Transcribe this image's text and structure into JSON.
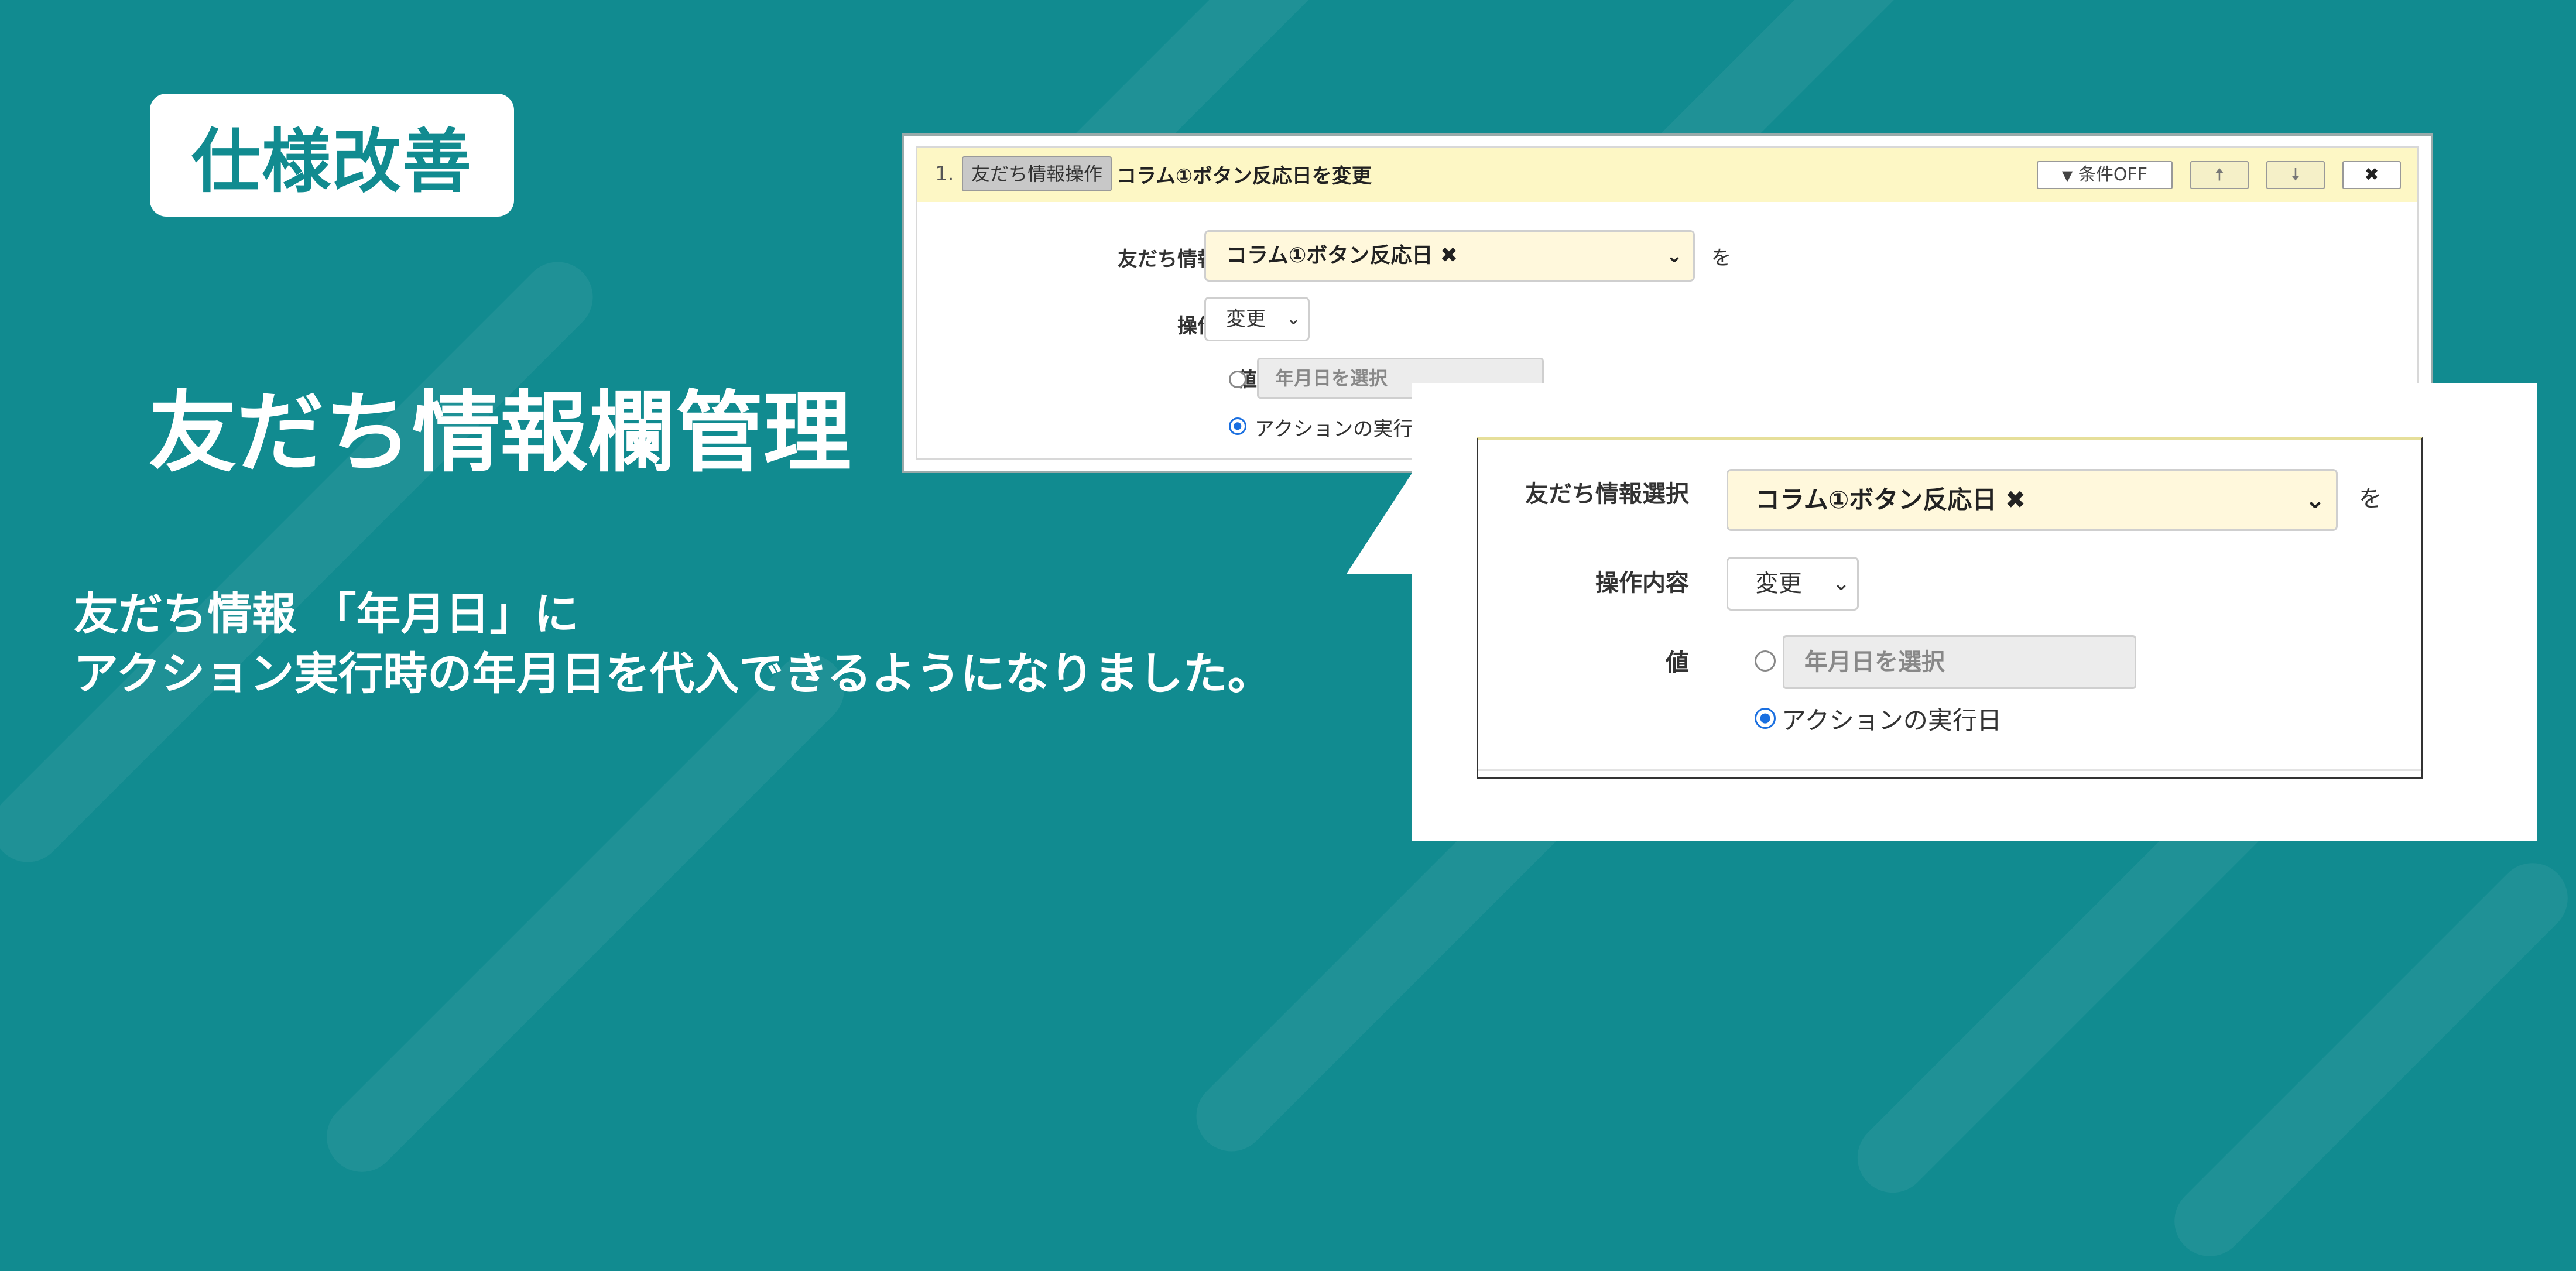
{
  "badge": "仕様改善",
  "main_title": "友だち情報欄管理",
  "description": [
    "友だち情報 「年月日」に",
    "アクション実行時の年月日を代入できるようになりました。"
  ],
  "panel": {
    "index": "1.",
    "tag": "友だち情報操作",
    "title": "コラム①ボタン反応日を変更",
    "condition_button": "条件OFF",
    "filter_icon": "filter-icon",
    "up_icon": "arrow-up-icon",
    "down_icon": "arrow-down-icon",
    "close_icon": "close-icon",
    "close_glyph": "✖",
    "up_glyph": "🠅",
    "down_glyph": "🠇",
    "filter_glyph": "▼"
  },
  "form": {
    "friend_info_label": "友だち情報選択",
    "friend_info_value": "コラム①ボタン反応日 ✖",
    "particle": "を",
    "operation_label": "操作内容",
    "operation_value": "変更",
    "value_label": "値",
    "date_placeholder": "年月日を選択",
    "action_date_option": "アクションの実行日",
    "selected_option": "アクションの実行日",
    "chevron": "⌄"
  },
  "colors": {
    "background": "#118b90",
    "header": "#fdf7c5",
    "radio_selected": "#1a6fe0"
  }
}
